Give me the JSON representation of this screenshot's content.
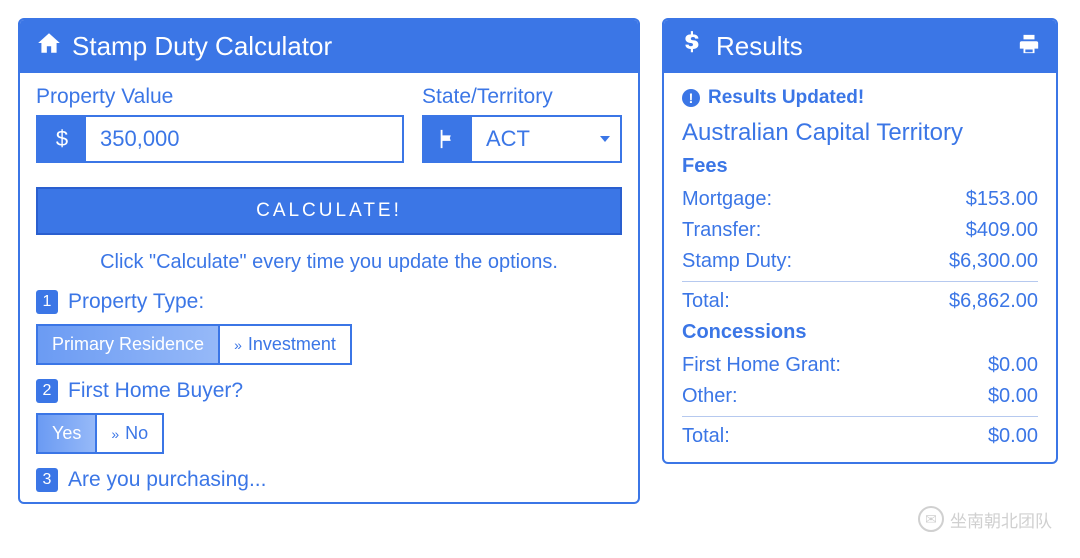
{
  "calculator": {
    "title": "Stamp Duty Calculator",
    "property_value": {
      "label": "Property Value",
      "value": "350,000",
      "addon": "$"
    },
    "state": {
      "label": "State/Territory",
      "selected": "ACT"
    },
    "calculate_label": "CALCULATE!",
    "hint": "Click \"Calculate\" every time you update the options.",
    "questions": {
      "q1": {
        "num": "1",
        "label": "Property Type:",
        "options": [
          "Primary Residence",
          "Investment"
        ],
        "selected": 0
      },
      "q2": {
        "num": "2",
        "label": "First Home Buyer?",
        "options": [
          "Yes",
          "No"
        ],
        "selected": 0
      },
      "q3": {
        "num": "3",
        "label": "Are you purchasing..."
      }
    }
  },
  "results": {
    "title": "Results",
    "alert": "Results Updated!",
    "state_name": "Australian Capital Territory",
    "fees_heading": "Fees",
    "fees": {
      "mortgage": {
        "label": "Mortgage:",
        "value": "$153.00"
      },
      "transfer": {
        "label": "Transfer:",
        "value": "$409.00"
      },
      "stamp_duty": {
        "label": "Stamp Duty:",
        "value": "$6,300.00"
      },
      "total": {
        "label": "Total:",
        "value": "$6,862.00"
      }
    },
    "concessions_heading": "Concessions",
    "concessions": {
      "fhg": {
        "label": "First Home Grant:",
        "value": "$0.00"
      },
      "other": {
        "label": "Other:",
        "value": "$0.00"
      },
      "total": {
        "label": "Total:",
        "value": "$0.00"
      }
    }
  },
  "watermark": "坐南朝北团队"
}
